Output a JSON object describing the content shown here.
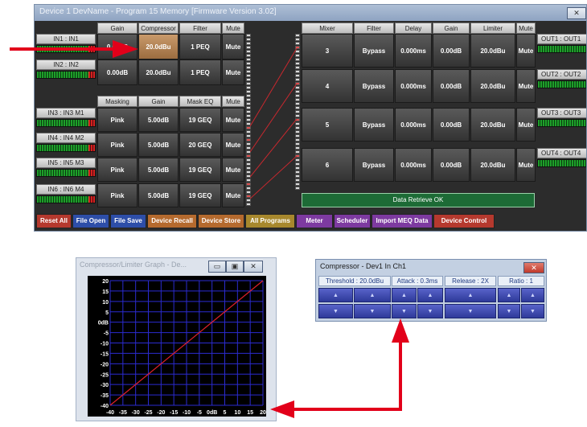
{
  "main": {
    "title": "Device 1 DevName  -  Program 15  Memory [Firmware Version 3.02]",
    "close_label": "✕",
    "input_headers": [
      "Gain",
      "Compressor",
      "Filter",
      "Mute"
    ],
    "masking_headers": [
      "Masking",
      "Gain",
      "Mask EQ",
      "Mute"
    ],
    "inputs": [
      {
        "label": "IN1 : IN1",
        "col1": "0.00dB",
        "col2": "20.0dBu",
        "col3": "1 PEQ",
        "mute": "Mute"
      },
      {
        "label": "IN2 : IN2",
        "col1": "0.00dB",
        "col2": "20.0dBu",
        "col3": "1 PEQ",
        "mute": "Mute"
      },
      {
        "label": "IN3 : IN3 M1",
        "col1": "Pink",
        "col2": "5.00dB",
        "col3": "19 GEQ",
        "mute": "Mute"
      },
      {
        "label": "IN4 : IN4 M2",
        "col1": "Pink",
        "col2": "5.00dB",
        "col3": "20 GEQ",
        "mute": "Mute"
      },
      {
        "label": "IN5 : IN5 M3",
        "col1": "Pink",
        "col2": "5.00dB",
        "col3": "19 GEQ",
        "mute": "Mute"
      },
      {
        "label": "IN6 : IN6 M4",
        "col1": "Pink",
        "col2": "5.00dB",
        "col3": "19 GEQ",
        "mute": "Mute"
      }
    ],
    "output_headers": [
      "Mixer",
      "Filter",
      "Delay",
      "Gain",
      "Limiter",
      "Mute"
    ],
    "outputs": [
      {
        "mixer": "3",
        "filter": "Bypass",
        "delay": "0.000ms",
        "gain": "0.00dB",
        "limiter": "20.0dBu",
        "mute": "Mute",
        "label": "OUT1 : OUT1"
      },
      {
        "mixer": "4",
        "filter": "Bypass",
        "delay": "0.000ms",
        "gain": "0.00dB",
        "limiter": "20.0dBu",
        "mute": "Mute",
        "label": "OUT2 : OUT2"
      },
      {
        "mixer": "5",
        "filter": "Bypass",
        "delay": "0.000ms",
        "gain": "0.00dB",
        "limiter": "20.0dBu",
        "mute": "Mute",
        "label": "OUT3 : OUT3"
      },
      {
        "mixer": "6",
        "filter": "Bypass",
        "delay": "0.000ms",
        "gain": "0.00dB",
        "limiter": "20.0dBu",
        "mute": "Mute",
        "label": "OUT4 : OUT4"
      }
    ],
    "status": "Data Retrieve OK",
    "buttons": [
      "Reset All",
      "File Open",
      "File Save",
      "Device Recall",
      "Device Store",
      "All Programs",
      "Meter",
      "Scheduler",
      "Import MEQ Data",
      "Device Control"
    ],
    "button_colors": [
      "#b5392e",
      "#2d4ea8",
      "#2d4ea8",
      "#b56a2e",
      "#b56a2e",
      "#a7882d",
      "#7d3aa0",
      "#7d3aa0",
      "#7d3aa0",
      "#b5392e"
    ]
  },
  "graph": {
    "title": "Compressor/Limiter Graph - De...",
    "min_label": "▭",
    "max_label": "▣",
    "close_label": "✕",
    "y_ticks": [
      "20",
      "15",
      "10",
      "5",
      "0dB",
      "-5",
      "-10",
      "-15",
      "-20",
      "-25",
      "-30",
      "-35",
      "-40"
    ],
    "x_ticks": [
      "-40",
      "-35",
      "-30",
      "-25",
      "-20",
      "-15",
      "-10",
      "-5",
      "0dB",
      "5",
      "10",
      "15",
      "20"
    ]
  },
  "compressor": {
    "title": "Compressor - Dev1 In Ch1",
    "close_label": "✕",
    "labels": [
      "Threshold : 20.0dBu",
      "Attack : 0.3ms",
      "Release : 2X",
      "Ratio : 1"
    ],
    "up": "▲",
    "down": "▼"
  },
  "colors": {
    "annotation": "#e2001a",
    "status_bg": "#1d6b36",
    "highlight": "#b8895a"
  }
}
